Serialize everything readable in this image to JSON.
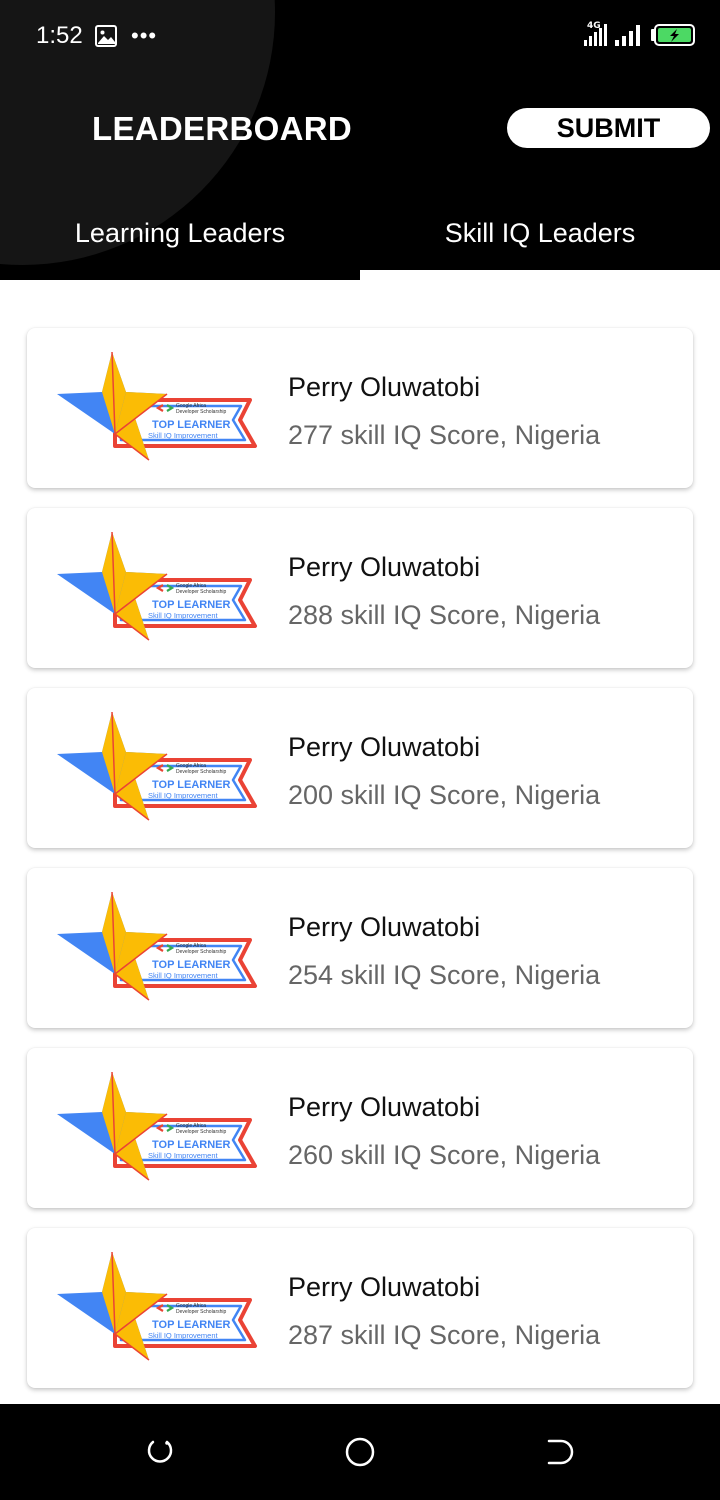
{
  "status_bar": {
    "time": "1:52",
    "icons": [
      "gallery-icon",
      "more-icon",
      "4g-icon",
      "signal-icon",
      "battery-charging-icon"
    ]
  },
  "header": {
    "title": "LEADERBOARD",
    "submit_label": "SUBMIT"
  },
  "tabs": [
    {
      "label": "Learning Leaders",
      "selected": false
    },
    {
      "label": "Skill IQ Leaders",
      "selected": true
    }
  ],
  "badge": {
    "org_line1": "Google Africa",
    "org_line2": "Developer Scholarship",
    "title": "TOP LEARNER",
    "subtitle": "Skill IQ Improvement"
  },
  "leaders": [
    {
      "name": "Perry Oluwatobi",
      "detail": "277 skill IQ Score, Nigeria"
    },
    {
      "name": "Perry Oluwatobi",
      "detail": "288 skill IQ Score, Nigeria"
    },
    {
      "name": "Perry Oluwatobi",
      "detail": "200 skill IQ Score, Nigeria"
    },
    {
      "name": "Perry Oluwatobi",
      "detail": "254 skill IQ Score, Nigeria"
    },
    {
      "name": "Perry Oluwatobi",
      "detail": "260 skill IQ Score, Nigeria"
    },
    {
      "name": "Perry Oluwatobi",
      "detail": "287 skill IQ Score, Nigeria"
    }
  ],
  "nav_bar": {
    "icons": [
      "recent-apps-icon",
      "home-icon",
      "back-icon"
    ]
  },
  "colors": {
    "header_bg": "#000000",
    "star_blue": "#4285F4",
    "star_yellow": "#FBBC05",
    "ribbon_red": "#EA4335",
    "secondary_text": "#666666"
  }
}
